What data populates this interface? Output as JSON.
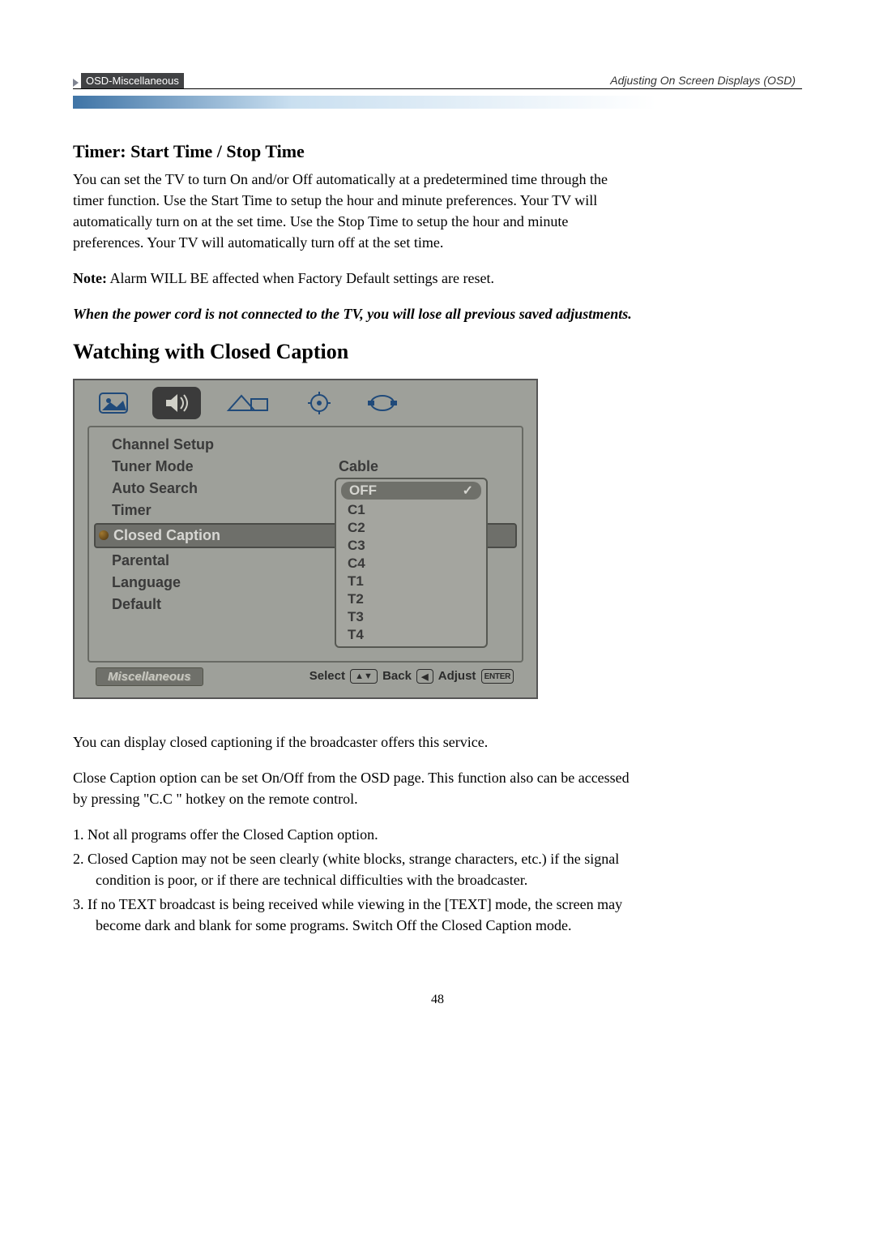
{
  "header": {
    "tab": "OSD-Miscellaneous",
    "right": "Adjusting On Screen Displays (OSD)"
  },
  "section1": {
    "title": "Timer: Start Time / Stop Time",
    "para": "You can set the TV to turn On and/or Off automatically at a predetermined time through the timer function. Use the Start Time to setup the hour and minute preferences. Your TV will automatically turn on at the set time. Use the Stop Time to setup the hour and minute preferences.  Your TV will automatically turn off at the set time.",
    "note_label": "Note:",
    "note_text": " Alarm WILL BE affected when Factory Default settings are reset.",
    "italic": "When the power cord is not connected to the TV, you will lose all previous saved adjustments."
  },
  "section2": {
    "title": "Watching with Closed Caption"
  },
  "osd": {
    "menu": {
      "channel_setup": "Channel Setup",
      "tuner_mode": "Tuner Mode",
      "tuner_mode_value": "Cable",
      "auto_search": "Auto Search",
      "timer": "Timer",
      "closed_caption": "Closed Caption",
      "parental": "Parental",
      "language": "Language",
      "default": "Default"
    },
    "dropdown": {
      "off": "OFF",
      "c1": "C1",
      "c2": "C2",
      "c3": "C3",
      "c4": "C4",
      "t1": "T1",
      "t2": "T2",
      "t3": "T3",
      "t4": "T4"
    },
    "footer": {
      "tab": "Miscellaneous",
      "select": "Select",
      "back": "Back",
      "adjust": "Adjust",
      "enter": "ENTER"
    }
  },
  "body_text": {
    "p1": "You can display closed captioning if the broadcaster offers this service.",
    "p2": "Close Caption option can be set On/Off from the OSD page. This function also can be accessed by pressing \"C.C \" hotkey on the remote control.",
    "li1": "1. Not all programs offer the Closed Caption option.",
    "li2": "2. Closed Caption may not be seen clearly (white blocks, strange characters, etc.) if the signal condition is poor, or if there are technical difficulties with the broadcaster.",
    "li3": "3. If no TEXT broadcast is being received while viewing in the [TEXT] mode, the screen may become dark and blank for some programs. Switch Off the Closed Caption mode."
  },
  "page_number": "48"
}
